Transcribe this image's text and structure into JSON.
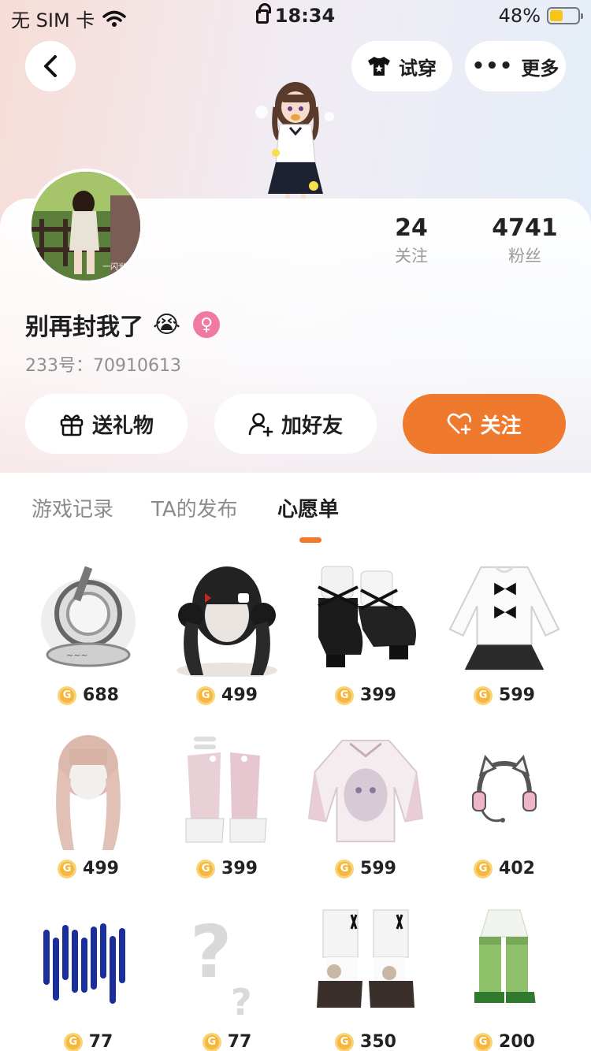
{
  "status_bar": {
    "carrier": "无 SIM 卡",
    "time": "18:34",
    "battery": "48%",
    "battery_level": 0.48
  },
  "top_bar": {
    "try_on_label": "试穿",
    "more_label": "更多"
  },
  "profile": {
    "following_count": "24",
    "following_label": "关注",
    "fans_count": "4741",
    "fans_label": "粉丝",
    "nickname": "别再封我了",
    "nickname_emoji": "😭",
    "gender_symbol": "♀",
    "id_text": "233号：70910613",
    "avatar_caption": "一闪光"
  },
  "actions": {
    "gift_label": "送礼物",
    "add_friend_label": "加好友",
    "follow_label": "关注"
  },
  "tabs": [
    {
      "label": "游戏记录",
      "active": false
    },
    {
      "label": "TA的发布",
      "active": true
    },
    {
      "label": "心愿单",
      "active": true
    }
  ],
  "wishlist": [
    {
      "item": "crystal-ring-badge",
      "price": "688"
    },
    {
      "item": "black-twin-bun-hair",
      "price": "499"
    },
    {
      "item": "black-strap-shoes",
      "price": "399"
    },
    {
      "item": "white-bow-top-black-skirt",
      "price": "599"
    },
    {
      "item": "pink-long-hair",
      "price": "499"
    },
    {
      "item": "pink-leg-warmer-boots",
      "price": "399"
    },
    {
      "item": "pink-anime-print-hoodie",
      "price": "599"
    },
    {
      "item": "cat-ear-headphones",
      "price": "402"
    },
    {
      "item": "blue-glow-bars",
      "price": "77"
    },
    {
      "item": "mystery-item",
      "price": "77"
    },
    {
      "item": "pompom-boots",
      "price": "350"
    },
    {
      "item": "green-leg-warmers",
      "price": "200"
    }
  ],
  "colors": {
    "accent": "#ef7a2e",
    "coin": "#f6b73c",
    "gender": "#f07aa0"
  }
}
